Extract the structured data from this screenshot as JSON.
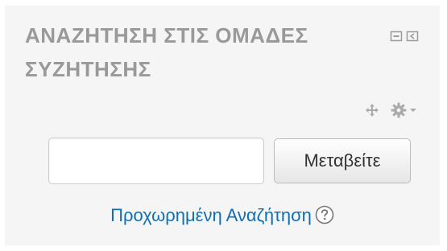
{
  "block": {
    "title_lines": [
      "ΑΝΑΖΗΤΗΣΗ ΣΤΙΣ ΟΜΑΔΕΣ",
      "ΣΥΖΗΤΗΣΗΣ"
    ],
    "controls": {
      "hide_icon": "minus-square-icon",
      "dock_icon": "dock-left-icon"
    },
    "tools": {
      "move_icon": "move-arrows-icon",
      "actions_icon": "gear-icon",
      "actions_menu_icon": "caret-down-icon"
    },
    "search": {
      "value": "",
      "placeholder": ""
    },
    "go_button_label": "Μεταβείτε",
    "advanced_search_label": "Προχωρημένη Αναζήτηση",
    "help_icon": "question-circle-icon"
  },
  "colors": {
    "block_background": "#f5f5f5",
    "title_text": "#999999",
    "link": "#0f6fb3",
    "icon": "#aaaaaa"
  }
}
